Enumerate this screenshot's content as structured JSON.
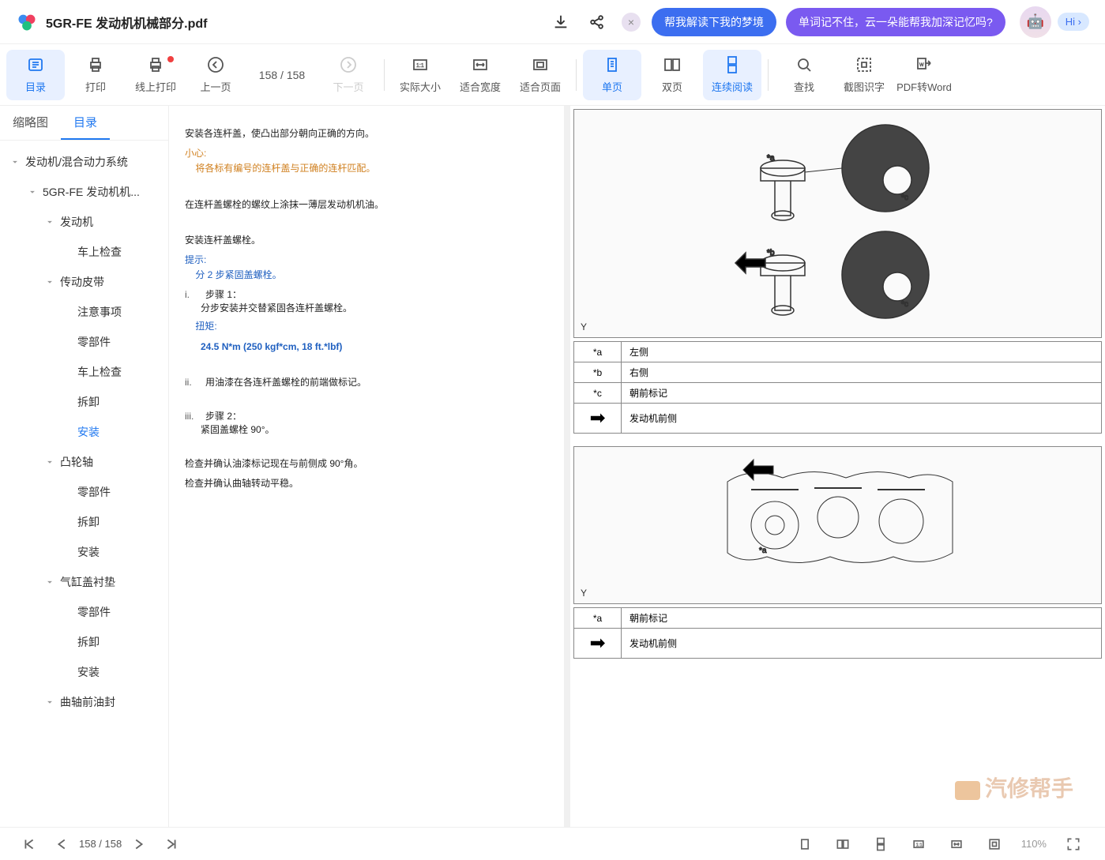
{
  "header": {
    "title": "5GR-FE 发动机机械部分.pdf",
    "chip_blue": "帮我解读下我的梦境",
    "chip_purple": "单词记不住，云一朵能帮我加深记忆吗?",
    "hi": "Hi ›"
  },
  "toolbar": {
    "items": [
      {
        "label": "目录",
        "icon": "toc",
        "active": true
      },
      {
        "label": "打印",
        "icon": "print"
      },
      {
        "label": "线上打印",
        "icon": "print-online",
        "reddot": true
      },
      {
        "label": "上一页",
        "icon": "prev"
      },
      {
        "label": "下一页",
        "icon": "next",
        "disabled": true
      },
      {
        "label": "实际大小",
        "icon": "actual"
      },
      {
        "label": "适合宽度",
        "icon": "fitw"
      },
      {
        "label": "适合页面",
        "icon": "fitp"
      },
      {
        "label": "单页",
        "icon": "single",
        "active": true
      },
      {
        "label": "双页",
        "icon": "double"
      },
      {
        "label": "连续阅读",
        "icon": "cont",
        "active": true
      },
      {
        "label": "查找",
        "icon": "find"
      },
      {
        "label": "截图识字",
        "icon": "ocr"
      },
      {
        "label": "PDF转Word",
        "icon": "convert"
      }
    ],
    "page_ind": "158 / 158"
  },
  "sidebar": {
    "tabs": [
      "缩略图",
      "目录"
    ],
    "tree": [
      {
        "label": "发动机/混合动力系统",
        "depth": 0,
        "caret": true
      },
      {
        "label": "5GR-FE 发动机机...",
        "depth": 1,
        "caret": true
      },
      {
        "label": "发动机",
        "depth": 2,
        "caret": true
      },
      {
        "label": "车上检查",
        "depth": 3
      },
      {
        "label": "传动皮带",
        "depth": 2,
        "caret": true
      },
      {
        "label": "注意事项",
        "depth": 3
      },
      {
        "label": "零部件",
        "depth": 3
      },
      {
        "label": "车上检查",
        "depth": 3
      },
      {
        "label": "拆卸",
        "depth": 3
      },
      {
        "label": "安装",
        "depth": 3,
        "sel": true
      },
      {
        "label": "凸轮轴",
        "depth": 2,
        "caret": true
      },
      {
        "label": "零部件",
        "depth": 3
      },
      {
        "label": "拆卸",
        "depth": 3
      },
      {
        "label": "安装",
        "depth": 3
      },
      {
        "label": "气缸盖衬垫",
        "depth": 2,
        "caret": true
      },
      {
        "label": "零部件",
        "depth": 3
      },
      {
        "label": "拆卸",
        "depth": 3
      },
      {
        "label": "安装",
        "depth": 3
      },
      {
        "label": "曲轴前油封",
        "depth": 2,
        "caret": true
      }
    ]
  },
  "pdf": {
    "line1": "安装各连杆盖，使凸出部分朝向正确的方向。",
    "warn_label": "小心:",
    "warn_text": "将各标有编号的连杆盖与正确的连杆匹配。",
    "line2": "在连杆盖螺栓的螺纹上涂抹一薄层发动机机油。",
    "line3": "安装连杆盖螺栓。",
    "hint_label": "提示:",
    "hint_text": "分 2 步紧固盖螺栓。",
    "step1_num": "i.",
    "step1_title": "步骤 1：",
    "step1_text": "分步安装并交替紧固各连杆盖螺栓。",
    "torque_label": "扭矩:",
    "torque_value": "24.5 N*m (250 kgf*cm, 18 ft.*lbf)",
    "step2_num": "ii.",
    "step2_text": "用油漆在各连杆盖螺栓的前端做标记。",
    "step3_num": "iii.",
    "step3_title": "步骤 2：",
    "step3_text": "紧固盖螺栓 90°。",
    "line4": "检查并确认油漆标记现在与前侧成 90°角。",
    "line5": "检查并确认曲轴转动平稳。",
    "table1": [
      {
        "k": "*a",
        "v": "左侧"
      },
      {
        "k": "*b",
        "v": "右侧"
      },
      {
        "k": "*c",
        "v": "朝前标记"
      }
    ],
    "arrow_text1": "发动机前侧",
    "table2_k": "*a",
    "table2_v": "朝前标记",
    "arrow_text2": "发动机前侧",
    "img_y": "Y"
  },
  "footer": {
    "page": "158 / 158",
    "zoom": "110%"
  },
  "watermark": "汽修帮手"
}
